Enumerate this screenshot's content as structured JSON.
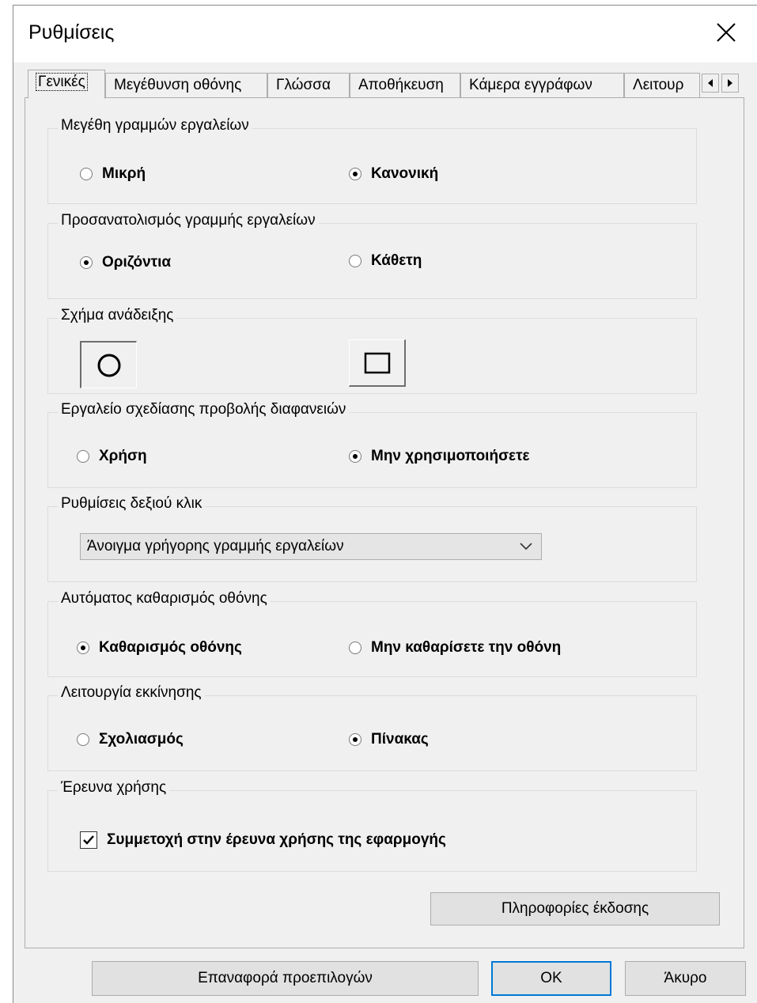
{
  "window": {
    "title": "Ρυθμίσεις"
  },
  "tabs": [
    {
      "label": "Γενικές",
      "active": true
    },
    {
      "label": "Μεγέθυνση οθόνης",
      "active": false
    },
    {
      "label": "Γλώσσα",
      "active": false
    },
    {
      "label": "Αποθήκευση",
      "active": false
    },
    {
      "label": "Κάμερα εγγράφων",
      "active": false
    },
    {
      "label": "Λειτουρ",
      "active": false
    }
  ],
  "groups": {
    "toolbar_size": {
      "label": "Μεγέθη γραμμών εργαλείων",
      "options": [
        {
          "label": "Μικρή",
          "selected": false
        },
        {
          "label": "Κανονική",
          "selected": true
        }
      ]
    },
    "toolbar_orientation": {
      "label": "Προσανατολισμός γραμμής εργαλείων",
      "options": [
        {
          "label": "Οριζόντια",
          "selected": true
        },
        {
          "label": "Κάθετη",
          "selected": false
        }
      ]
    },
    "highlight_shape": {
      "label": "Σχήμα ανάδειξης",
      "options": [
        {
          "shape": "circle-icon",
          "selected": true
        },
        {
          "shape": "square-icon",
          "selected": false
        }
      ]
    },
    "slide_drawing_tool": {
      "label": "Εργαλείο σχεδίασης προβολής διαφανειών",
      "options": [
        {
          "label": "Χρήση",
          "selected": false
        },
        {
          "label": "Μην χρησιμοποιήσετε",
          "selected": true
        }
      ]
    },
    "right_click": {
      "label": "Ρυθμίσεις δεξιού κλικ",
      "selected_value": "Άνοιγμα γρήγορης γραμμής εργαλείων"
    },
    "auto_clear": {
      "label": "Αυτόματος καθαρισμός οθόνης",
      "options": [
        {
          "label": "Καθαρισμός οθόνης",
          "selected": true
        },
        {
          "label": "Μην καθαρίσετε την οθόνη",
          "selected": false
        }
      ]
    },
    "startup_mode": {
      "label": "Λειτουργία εκκίνησης",
      "options": [
        {
          "label": "Σχολιασμός",
          "selected": false
        },
        {
          "label": "Πίνακας",
          "selected": true
        }
      ]
    },
    "usage_survey": {
      "label": "Έρευνα χρήσης",
      "checkbox_label": "Συμμετοχή στην έρευνα χρήσης της εφαρμογής",
      "checked": true
    }
  },
  "buttons": {
    "version_info": "Πληροφορίες έκδοσης",
    "reset_defaults": "Επαναφορά προεπιλογών",
    "ok": "OK",
    "cancel": "Άκυρο"
  },
  "colors": {
    "dialog_bg": "#f0f0f0",
    "accent": "#0078d7"
  }
}
